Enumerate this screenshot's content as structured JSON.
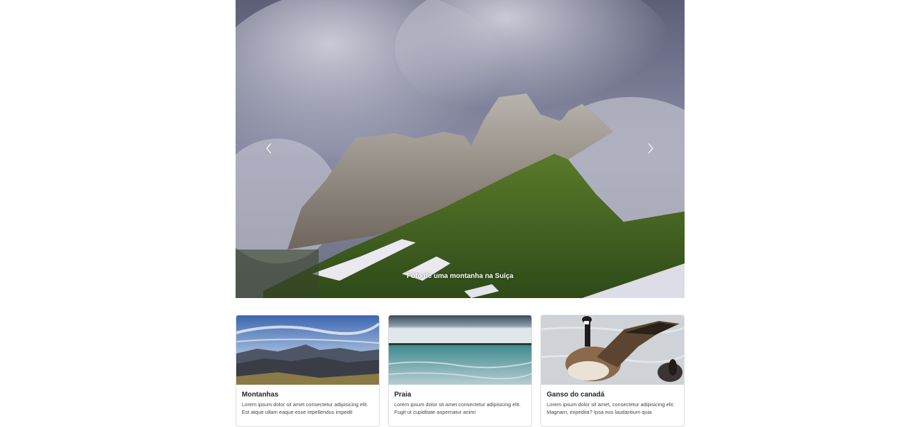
{
  "carousel": {
    "caption": "Foto de uma montanha na Suíça",
    "prev_icon": "chevron-left-icon",
    "next_icon": "chevron-right-icon"
  },
  "cards": [
    {
      "title": "Montanhas",
      "text": "Lorem ipsum dolor sit amet consectetur adipisicing elit. Est atque ullam eaque esse repellendus impedit"
    },
    {
      "title": "Praia",
      "text": "Lorem ipsum dolor sit amet consectetur adipisicing elit. Fugit ut cupiditate aspernatur animi"
    },
    {
      "title": "Ganso do canadá",
      "text": "Lorem ipsum dolor sit amet, consectetur adipisicing elit. Magnam, expedita? Ipsa eos laudantium quia"
    }
  ]
}
